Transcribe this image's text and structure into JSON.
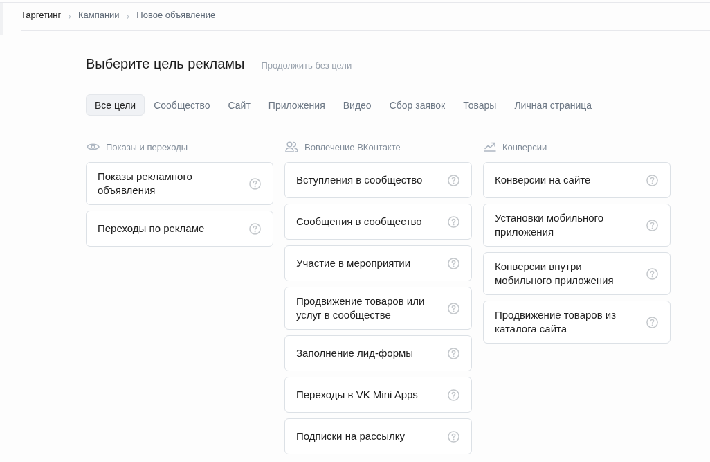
{
  "breadcrumbs": {
    "items": [
      "Таргетинг",
      "Кампании",
      "Новое объявление"
    ],
    "separators": [
      "›",
      "›"
    ]
  },
  "title": "Выберите цель рекламы",
  "skip_link": "Продолжить без цели",
  "tabs": [
    {
      "label": "Все цели",
      "selected": true
    },
    {
      "label": "Сообщество",
      "selected": false
    },
    {
      "label": "Сайт",
      "selected": false
    },
    {
      "label": "Приложения",
      "selected": false
    },
    {
      "label": "Видео",
      "selected": false
    },
    {
      "label": "Сбор заявок",
      "selected": false
    },
    {
      "label": "Товары",
      "selected": false
    },
    {
      "label": "Личная страница",
      "selected": false
    }
  ],
  "columns": [
    {
      "kind": "views",
      "title": "Показы и переходы",
      "goals": [
        "Показы рекламного объявления",
        "Переходы по рекламе"
      ]
    },
    {
      "kind": "community",
      "title": "Вовлечение ВКонтакте",
      "goals": [
        "Вступления в сообщество",
        "Сообщения в сообщество",
        "Участие в мероприятии",
        "Продвижение товаров или услуг в сообществе",
        "Заполнение лид-формы",
        "Переходы в VK Mini Apps",
        "Подписки на рассылку"
      ]
    },
    {
      "kind": "conversions",
      "title": "Конверсии",
      "goals": [
        "Конверсии на сайте",
        "Установки мобильного приложения",
        "Конверсии внутри мобильного приложения",
        "Продвижение товаров из каталога сайта"
      ]
    }
  ]
}
